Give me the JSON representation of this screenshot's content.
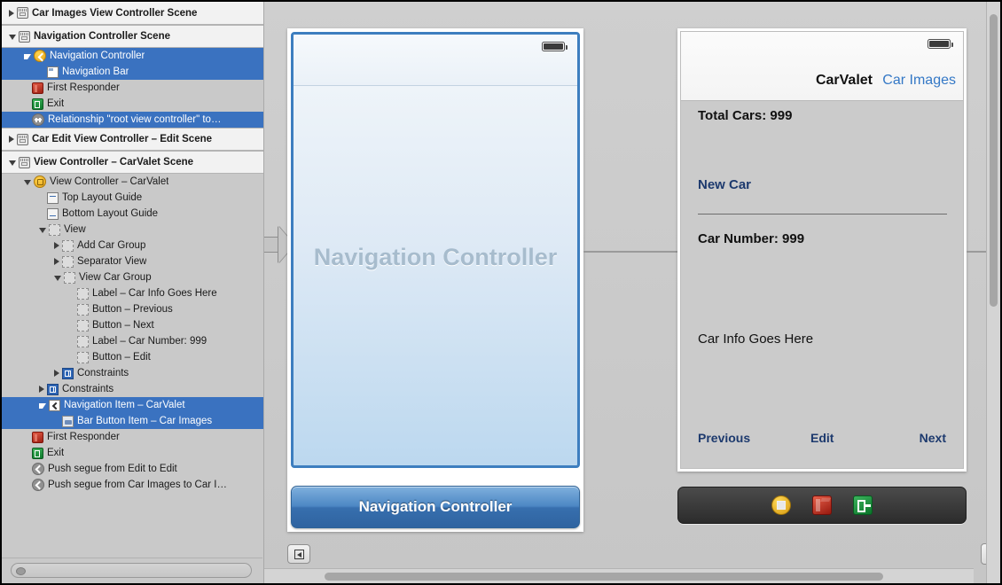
{
  "outline": {
    "rows": [
      {
        "label": "Car Images View Controller Scene",
        "type": "scene",
        "twisty": "right",
        "icon": "scene-icon",
        "indent": 0,
        "selected": false
      },
      {
        "label": "Navigation Controller Scene",
        "type": "scene",
        "twisty": "down",
        "icon": "scene-icon",
        "indent": 0,
        "selected": false
      },
      {
        "label": "Navigation Controller",
        "type": "item",
        "twisty": "down",
        "icon": "navigation-controller-icon",
        "indent": 1,
        "selected": true
      },
      {
        "label": "Navigation Bar",
        "type": "item",
        "twisty": "none",
        "icon": "navigation-bar-icon",
        "indent": 2,
        "selected": true
      },
      {
        "label": "First Responder",
        "type": "item",
        "twisty": "none",
        "icon": "first-responder-icon",
        "indent": 1,
        "selected": false
      },
      {
        "label": "Exit",
        "type": "item",
        "twisty": "none",
        "icon": "exit-icon",
        "indent": 1,
        "selected": false
      },
      {
        "label": "Relationship \"root view controller\" to…",
        "type": "item",
        "twisty": "none",
        "icon": "relationship-icon",
        "indent": 1,
        "selected": true
      },
      {
        "label": "Car Edit View Controller – Edit Scene",
        "type": "scene",
        "twisty": "right",
        "icon": "scene-icon",
        "indent": 0,
        "selected": false
      },
      {
        "label": "View Controller – CarValet Scene",
        "type": "scene",
        "twisty": "down",
        "icon": "scene-icon",
        "indent": 0,
        "selected": false
      },
      {
        "label": "View Controller – CarValet",
        "type": "item",
        "twisty": "down",
        "icon": "view-controller-icon",
        "indent": 1,
        "selected": false
      },
      {
        "label": "Top Layout Guide",
        "type": "item",
        "twisty": "none",
        "icon": "top-layout-guide-icon",
        "indent": 2,
        "selected": false
      },
      {
        "label": "Bottom Layout Guide",
        "type": "item",
        "twisty": "none",
        "icon": "bottom-layout-guide-icon",
        "indent": 2,
        "selected": false
      },
      {
        "label": "View",
        "type": "item",
        "twisty": "down",
        "icon": "view-icon",
        "indent": 2,
        "selected": false
      },
      {
        "label": "Add Car Group",
        "type": "item",
        "twisty": "right",
        "icon": "view-icon",
        "indent": 3,
        "selected": false
      },
      {
        "label": "Separator View",
        "type": "item",
        "twisty": "right",
        "icon": "view-icon",
        "indent": 3,
        "selected": false
      },
      {
        "label": "View Car Group",
        "type": "item",
        "twisty": "down",
        "icon": "view-icon",
        "indent": 3,
        "selected": false
      },
      {
        "label": "Label – Car Info Goes Here",
        "type": "item",
        "twisty": "none",
        "icon": "view-icon",
        "indent": 4,
        "selected": false
      },
      {
        "label": "Button – Previous",
        "type": "item",
        "twisty": "none",
        "icon": "view-icon",
        "indent": 4,
        "selected": false
      },
      {
        "label": "Button – Next",
        "type": "item",
        "twisty": "none",
        "icon": "view-icon",
        "indent": 4,
        "selected": false
      },
      {
        "label": "Label – Car Number: 999",
        "type": "item",
        "twisty": "none",
        "icon": "view-icon",
        "indent": 4,
        "selected": false
      },
      {
        "label": "Button – Edit",
        "type": "item",
        "twisty": "none",
        "icon": "view-icon",
        "indent": 4,
        "selected": false
      },
      {
        "label": "Constraints",
        "type": "item",
        "twisty": "right",
        "icon": "constraints-icon",
        "indent": 3,
        "selected": false
      },
      {
        "label": "Constraints",
        "type": "item",
        "twisty": "right",
        "icon": "constraints-icon",
        "indent": 2,
        "selected": false
      },
      {
        "label": "Navigation Item – CarValet",
        "type": "item",
        "twisty": "down",
        "icon": "navigation-item-icon",
        "indent": 2,
        "selected": true
      },
      {
        "label": "Bar Button Item – Car Images",
        "type": "item",
        "twisty": "none",
        "icon": "bar-button-item-icon",
        "indent": 3,
        "selected": true
      },
      {
        "label": "First Responder",
        "type": "item",
        "twisty": "none",
        "icon": "first-responder-icon",
        "indent": 1,
        "selected": false
      },
      {
        "label": "Exit",
        "type": "item",
        "twisty": "none",
        "icon": "exit-icon",
        "indent": 1,
        "selected": false
      },
      {
        "label": "Push segue from Edit to Edit",
        "type": "item",
        "twisty": "none",
        "icon": "segue-icon",
        "indent": 1,
        "selected": false
      },
      {
        "label": "Push segue from Car Images to Car I…",
        "type": "item",
        "twisty": "none",
        "icon": "segue-icon",
        "indent": 1,
        "selected": false
      }
    ],
    "filter_placeholder": ""
  },
  "canvas": {
    "nav_scene": {
      "placeholder_label": "Navigation Controller",
      "scene_label": "Navigation Controller",
      "battery_icon": "battery-icon"
    },
    "carvalet_scene": {
      "nav_title": "CarValet",
      "nav_right_button": "Car Images",
      "total_cars_label": "Total Cars: 999",
      "new_car_button": "New Car",
      "car_number_label": "Car Number: 999",
      "car_info_label": "Car Info Goes Here",
      "previous_button": "Previous",
      "edit_button": "Edit",
      "next_button": "Next",
      "battery_icon": "battery-icon"
    },
    "segue": {
      "icon": "segue-relationship-icon"
    },
    "dock": {
      "items": [
        {
          "name": "view-controller-dock-icon"
        },
        {
          "name": "first-responder-dock-icon"
        },
        {
          "name": "exit-dock-icon"
        }
      ]
    }
  },
  "bottom_bar": {
    "align_group": [
      {
        "icon": "align-icon"
      }
    ],
    "pin_group": [
      {
        "icon": "resolve-layout-icon"
      },
      {
        "icon": "pin-horizontal-icon"
      },
      {
        "icon": "pin-spacing-icon"
      },
      {
        "icon": "resize-behavior-icon"
      }
    ],
    "zoom_group": [
      {
        "icon": "zoom-out-icon"
      },
      {
        "icon": "zoom-actual-icon"
      },
      {
        "icon": "zoom-in-icon"
      }
    ],
    "collapse_button": {
      "icon": "collapse-panel-icon"
    }
  },
  "colors": {
    "selection_blue": "#3a72c0",
    "device_border_blue": "#3d7ebf",
    "link_blue": "#3478c6",
    "button_navy": "#1d3a6e"
  }
}
